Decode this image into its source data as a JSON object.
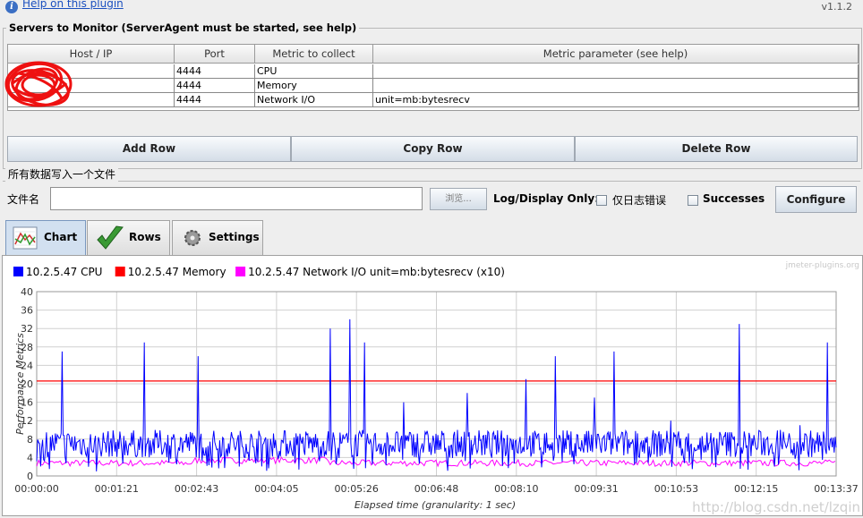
{
  "header": {
    "help_link": "Help on this plugin",
    "version": "v1.1.2"
  },
  "servers": {
    "title": "Servers to Monitor (ServerAgent must be started, see help)",
    "columns": [
      "Host / IP",
      "Port",
      "Metric to collect",
      "Metric parameter (see help)"
    ],
    "rows": [
      {
        "port": "4444",
        "metric": "CPU",
        "param": ""
      },
      {
        "port": "4444",
        "metric": "Memory",
        "param": ""
      },
      {
        "port": "4444",
        "metric": "Network I/O",
        "param": "unit=mb:bytesrecv"
      }
    ],
    "add_row": "Add Row",
    "copy_row": "Copy Row",
    "delete_row": "Delete Row"
  },
  "file": {
    "group_title": "所有数据写入一个文件",
    "label": "文件名",
    "browse": "浏览...",
    "log_display_only": "Log/Display Only:",
    "errors_only": "仅日志错误",
    "successes": "Successes",
    "configure": "Configure"
  },
  "tabs": [
    {
      "label": "Chart",
      "active": true
    },
    {
      "label": "Rows"
    },
    {
      "label": "Settings"
    }
  ],
  "colors": {
    "cpu": "#0000ff",
    "memory": "#ff0000",
    "network": "#ff00ff",
    "grid": "#d0d0d0"
  },
  "chart_data": {
    "type": "line",
    "watermark": "jmeter-plugins.org",
    "ylabel": "Performance Metrics",
    "xlabel": "Elapsed time (granularity: 1 sec)",
    "ylim": [
      0,
      40
    ],
    "yticks": [
      "0",
      "4",
      "8",
      "12",
      "16",
      "20",
      "24",
      "28",
      "32",
      "36",
      "40"
    ],
    "xticks": [
      "00:00:00",
      "00:01:21",
      "00:02:43",
      "00:04:05",
      "00:05:26",
      "00:06:48",
      "00:08:10",
      "00:09:31",
      "00:10:53",
      "00:12:15",
      "00:13:37"
    ],
    "x_range_seconds": [
      0,
      817
    ],
    "series": [
      {
        "name": "10.2.5.47 CPU",
        "baseline": 7,
        "spikes_seconds_value": [
          [
            26,
            27
          ],
          [
            53,
            2
          ],
          [
            61,
            1
          ],
          [
            110,
            29
          ],
          [
            165,
            26
          ],
          [
            300,
            32
          ],
          [
            320,
            34
          ],
          [
            335,
            29
          ],
          [
            375,
            16
          ],
          [
            440,
            18
          ],
          [
            478,
            8
          ],
          [
            500,
            21
          ],
          [
            530,
            26
          ],
          [
            570,
            17
          ],
          [
            590,
            27
          ],
          [
            648,
            12
          ],
          [
            718,
            33
          ],
          [
            760,
            10
          ],
          [
            780,
            11
          ],
          [
            808,
            29
          ]
        ]
      },
      {
        "name": "10.2.5.47 Memory",
        "level": 20.6
      },
      {
        "name": "10.2.5.47 Network I/O unit=mb:bytesrecv (x10)",
        "level": 2.8
      }
    ]
  },
  "blog_watermark": "http://blog.csdn.net/lzqin"
}
